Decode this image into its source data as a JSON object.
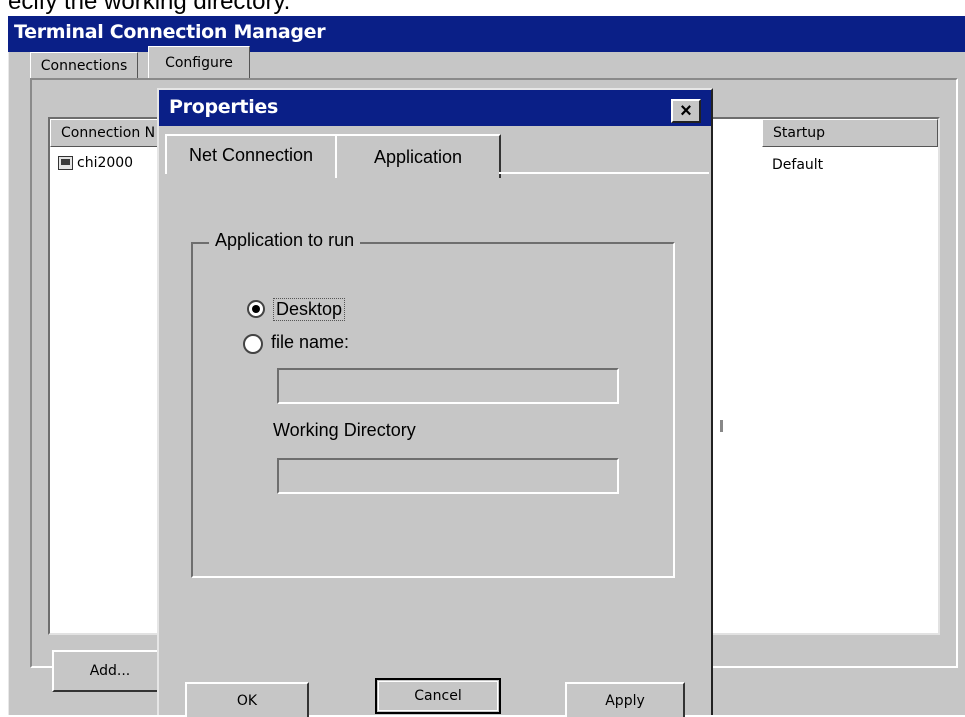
{
  "caption": "ecify the working directory.",
  "main_window": {
    "title": "Terminal Connection Manager",
    "tabs": [
      {
        "label": "Connections"
      },
      {
        "label": "Configure"
      }
    ],
    "list": {
      "columns": {
        "name": "Connection N",
        "startup": "Startup"
      },
      "rows": [
        {
          "name": "chi2000",
          "startup": "Default"
        }
      ]
    },
    "add_button": "Add..."
  },
  "dialog": {
    "title": "Properties",
    "close_glyph": "×",
    "tabs": [
      {
        "label": "Net Connection"
      },
      {
        "label": "Application",
        "selected": true
      }
    ],
    "group_label": "Application to run",
    "options": [
      {
        "label": "Desktop",
        "checked": true
      },
      {
        "label": "file name:",
        "checked": false
      }
    ],
    "file_name_value": "",
    "working_directory_label": "Working Directory",
    "working_directory_value": "",
    "buttons": {
      "ok": "OK",
      "cancel": "Cancel",
      "apply": "Apply"
    }
  },
  "colors": {
    "titlebar": "#0a1f87",
    "face": "#c6c6c6"
  }
}
